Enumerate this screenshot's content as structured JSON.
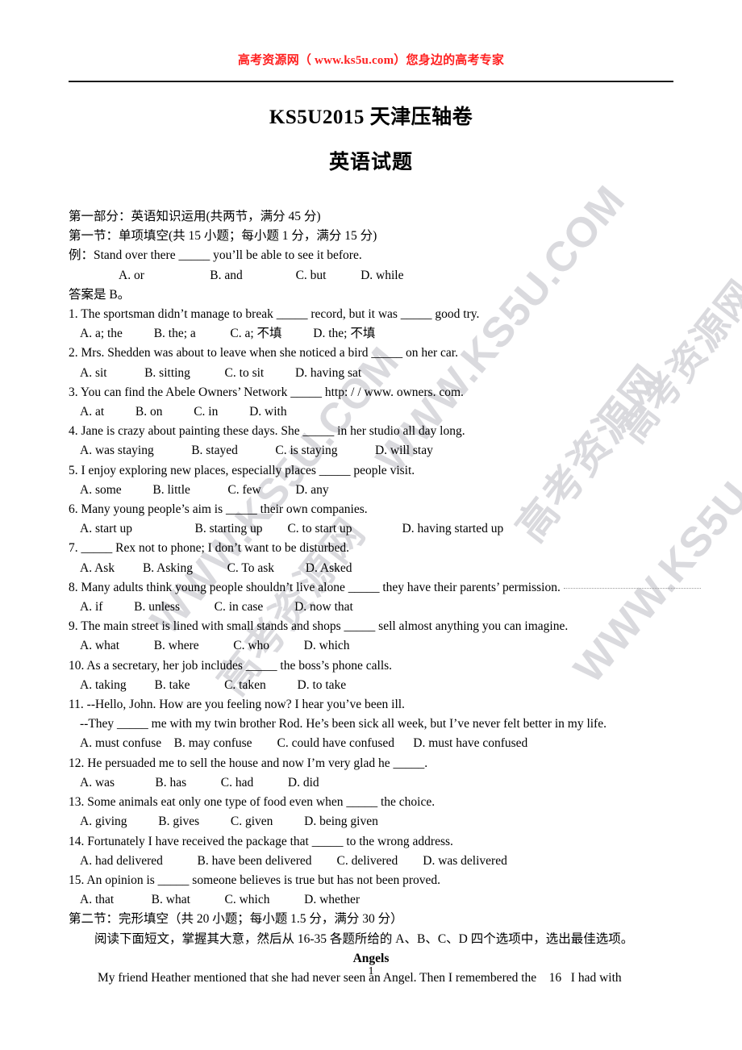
{
  "banner": {
    "text": "高考资源网（ www.ks5u.com）您身边的高考专家",
    "color": "#ff2020"
  },
  "title": {
    "main": "KS5U2015 天津压轴卷",
    "sub": "英语试题"
  },
  "part_one": {
    "heading": "第一部分：英语知识运用(共两节，满分 45 分)",
    "section_one_heading": "第一节：单项填空(共 15 小题；每小题 1 分，满分 15 分)",
    "example_stem": "例：Stand over there _____ you’ll be able to see it before.",
    "example_options": "A. or                     B. and                 C. but           D. while",
    "example_answer": "答案是 B。"
  },
  "questions": [
    {
      "stem": "1. The sportsman didn’t manage to break _____ record, but it was _____ good try.",
      "options": "A. a; the          B. the; a           C. a; 不填          D. the; 不填"
    },
    {
      "stem": "2. Mrs. Shedden was about to leave when she noticed a bird _____ on her car.",
      "options": "A. sit            B. sitting           C. to sit          D. having sat"
    },
    {
      "stem": "3. You can find the Abele Owners’ Network _____ http: / / www. owners. com.",
      "options": "A. at          B. on          C. in          D. with"
    },
    {
      "stem": "4. Jane is crazy about painting these days. She _____ in her studio all day long.",
      "options": "A. was staying            B. stayed            C. is staying            D. will stay"
    },
    {
      "stem": "5. I enjoy exploring new places, especially places _____ people visit.",
      "options": "A. some          B. little            C. few           D. any"
    },
    {
      "stem": "6. Many young people’s aim is _____ their own companies.",
      "options": "A. start up                    B. starting up        C. to start up                D. having started up"
    },
    {
      "stem": "7. _____ Rex not to phone; I don’t want to be disturbed.",
      "options": "A. Ask         B. Asking           C. To ask          D. Asked"
    },
    {
      "stem": "8. Many adults think young people shouldn’t live alone _____ they have their parents’ permission.",
      "options": "A. if          B. unless           C. in case          D. now that",
      "dotted_tail": true
    },
    {
      "stem": "9. The main street is lined with small stands and shops _____ sell almost anything you can imagine.",
      "options": "A. what           B. where           C. who           D. which"
    },
    {
      "stem": "10. As a secretary, her job includes _____ the boss’s phone calls.",
      "options": "A. taking         B. take           C. taken          D. to take"
    },
    {
      "stem": "11. --Hello, John. How are you feeling now? I hear you’ve been ill.",
      "stem2": "--They _____ me with my twin brother Rod. He’s been sick all week, but I’ve never felt better in my life.",
      "options": "A. must confuse    B. may confuse        C. could have confused      D. must have confused"
    },
    {
      "stem": "12. He persuaded me to sell the house and now I’m very glad he _____.",
      "options": "A. was             B. has           C. had           D. did"
    },
    {
      "stem": "13. Some animals eat only one type of food even when _____ the choice.",
      "options": "A. giving          B. gives          C. given          D. being given"
    },
    {
      "stem": "14. Fortunately I have received the package that _____ to the wrong address.",
      "options": "A. had delivered           B. have been delivered        C. delivered        D. was delivered"
    },
    {
      "stem": "15. An opinion is _____ someone believes is true but has not been proved.",
      "options": "A. that            B. what           C. which           D. whether"
    }
  ],
  "section_two": {
    "heading": "第二节：完形填空（共 20 小题；每小题 1.5 分，满分 30 分）",
    "instruction": "阅读下面短文，掌握其大意，然后从 16-35 各题所给的 A、B、C、D 四个选项中，选出最佳选项。",
    "passage_title": "Angels",
    "passage_line": "My friend Heather mentioned that she had never seen an Angel. Then I remembered the    16   I had with"
  },
  "footer": {
    "page_number": "1"
  },
  "watermarks": {
    "url": "WWW.KS5U.COM",
    "cn": "高考资源网",
    "color": "#d9d9dd"
  }
}
